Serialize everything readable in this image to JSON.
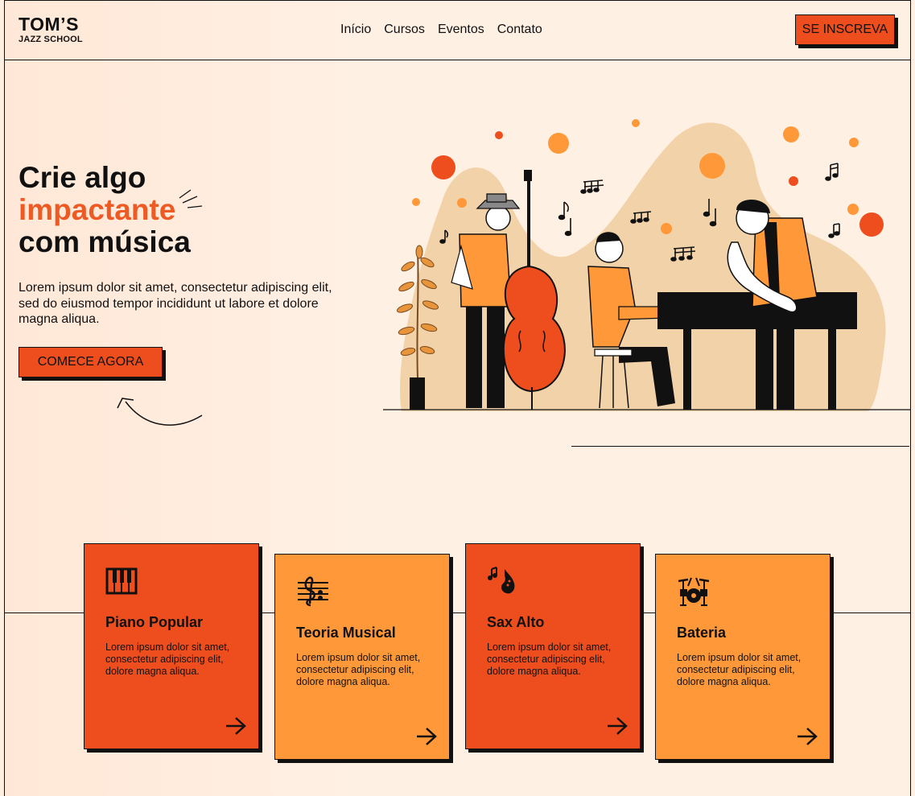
{
  "header": {
    "logo_main": "TOM’S",
    "logo_sub": "JAZZ SCHOOL",
    "nav": [
      "Início",
      "Cursos",
      "Eventos",
      "Contato"
    ],
    "signup_label": "SE INSCREVA"
  },
  "hero": {
    "title_line1": "Crie algo",
    "title_line2": "impactante",
    "title_line3": "com música",
    "text": "Lorem ipsum dolor sit amet, consectetur adipiscing elit, sed do eiusmod tempor incididunt ut labore et dolore magna aliqua.",
    "cta_label": "COMECE AGORA"
  },
  "cards": [
    {
      "title": "Piano Popular",
      "text": "Lorem ipsum dolor sit amet, consectetur adipiscing elit, dolore magna aliqua.",
      "icon": "piano-keys-icon"
    },
    {
      "title": "Teoria Musical",
      "text": "Lorem ipsum dolor sit amet, consectetur adipiscing elit, dolore magna aliqua.",
      "icon": "music-staff-icon"
    },
    {
      "title": "Sax Alto",
      "text": "Lorem ipsum dolor sit amet, consectetur adipiscing elit, dolore magna aliqua.",
      "icon": "saxophone-icon"
    },
    {
      "title": "Bateria",
      "text": "Lorem ipsum dolor sit amet, consectetur adipiscing elit, dolore magna aliqua.",
      "icon": "drum-kit-icon"
    }
  ],
  "colors": {
    "background": "#ffefe3",
    "accent_red": "#ee4e1e",
    "accent_orange": "#ff9838",
    "title_accent": "#ee5a24",
    "ink": "#111111"
  }
}
